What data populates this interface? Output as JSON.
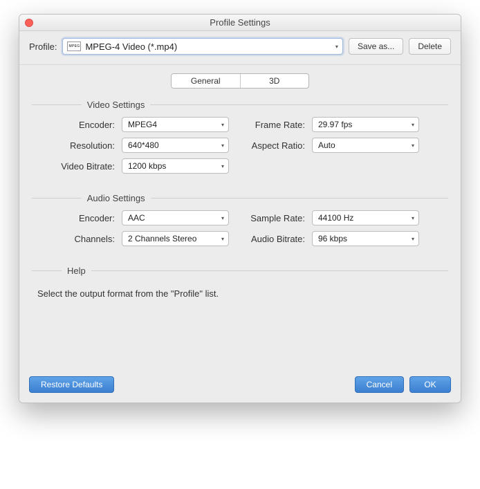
{
  "window": {
    "title": "Profile Settings"
  },
  "toolbar": {
    "profile_label": "Profile:",
    "profile_value": "MPEG-4 Video (*.mp4)",
    "profile_icon_text": "MPEG",
    "save_as_label": "Save as...",
    "delete_label": "Delete"
  },
  "tabs": {
    "general": "General",
    "three_d": "3D"
  },
  "sections": {
    "video": {
      "title": "Video Settings",
      "encoder_label": "Encoder:",
      "encoder_value": "MPEG4",
      "resolution_label": "Resolution:",
      "resolution_value": "640*480",
      "video_bitrate_label": "Video Bitrate:",
      "video_bitrate_value": "1200 kbps",
      "frame_rate_label": "Frame Rate:",
      "frame_rate_value": "29.97 fps",
      "aspect_ratio_label": "Aspect Ratio:",
      "aspect_ratio_value": "Auto"
    },
    "audio": {
      "title": "Audio Settings",
      "encoder_label": "Encoder:",
      "encoder_value": "AAC",
      "channels_label": "Channels:",
      "channels_value": "2 Channels Stereo",
      "sample_rate_label": "Sample Rate:",
      "sample_rate_value": "44100 Hz",
      "audio_bitrate_label": "Audio Bitrate:",
      "audio_bitrate_value": "96 kbps"
    },
    "help": {
      "title": "Help",
      "text": "Select the output format from the \"Profile\" list."
    }
  },
  "footer": {
    "restore_label": "Restore Defaults",
    "cancel_label": "Cancel",
    "ok_label": "OK"
  }
}
